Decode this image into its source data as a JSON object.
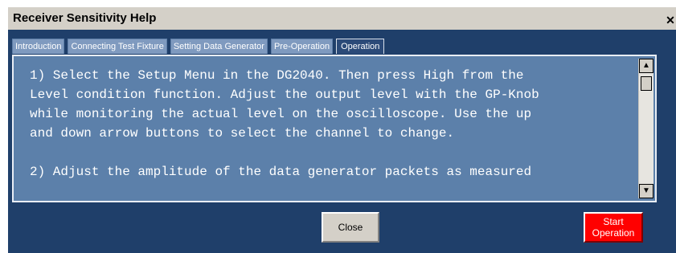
{
  "window": {
    "title": "Receiver Sensitivity Help"
  },
  "tabs": [
    {
      "label": "Introduction"
    },
    {
      "label": "Connecting Test Fixture"
    },
    {
      "label": "Setting Data Generator"
    },
    {
      "label": "Pre-Operation"
    },
    {
      "label": "Operation"
    }
  ],
  "content": {
    "text": "1) Select the Setup Menu in the DG2040. Then press High from the\nLevel condition function. Adjust the output level with the GP-Knob\nwhile monitoring the actual level on the oscilloscope. Use the up\nand down arrow buttons to select the channel to change.\n\n2) Adjust the amplitude of the data generator packets as measured"
  },
  "buttons": {
    "close": "Close",
    "start": "Start\nOperation"
  },
  "icons": {
    "close_window": "close-icon",
    "scroll_up": "arrow-up-icon",
    "scroll_down": "arrow-down-icon"
  },
  "colors": {
    "panel_bg": "#1f3f6a",
    "content_bg": "#5c80aa",
    "start_button": "#ff0000"
  }
}
